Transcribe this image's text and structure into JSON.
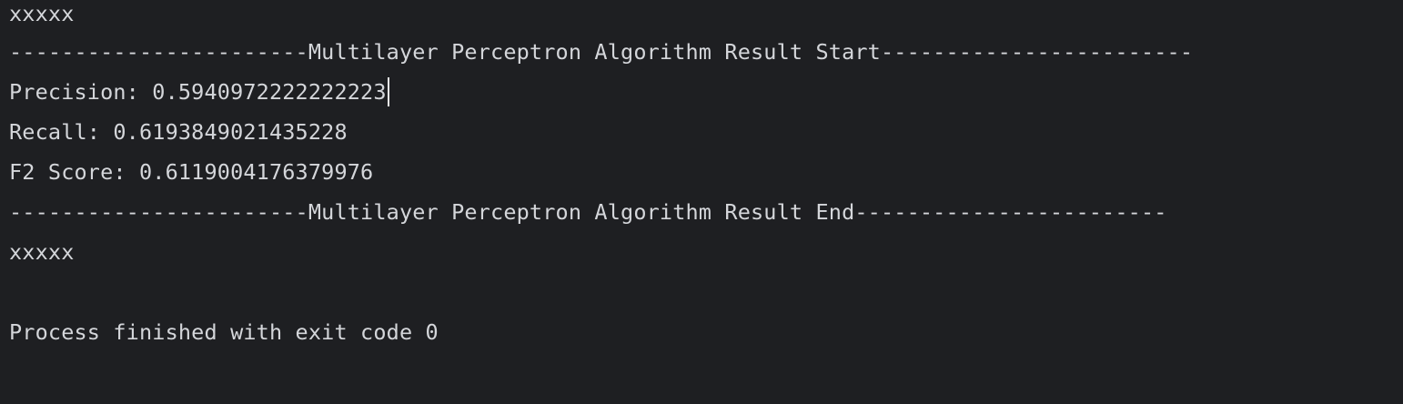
{
  "console": {
    "lines": [
      "xxxxx",
      "-----------------------Multilayer Perceptron Algorithm Result Start------------------------",
      "Precision: 0.5940972222222223",
      "Recall: 0.6193849021435228",
      "F2 Score: 0.6119004176379976",
      "-----------------------Multilayer Perceptron Algorithm Result End------------------------",
      "xxxxx",
      "Process finished with exit code 0"
    ]
  }
}
